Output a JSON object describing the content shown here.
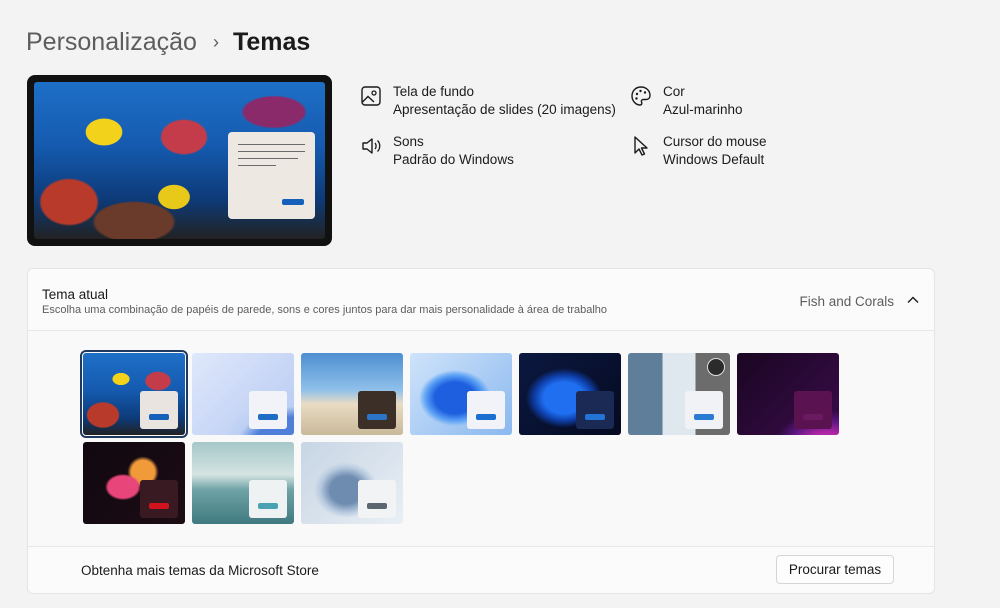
{
  "breadcrumb": {
    "parent": "Personalização",
    "separator": "›",
    "current": "Temas"
  },
  "properties": {
    "background": {
      "label": "Tela de fundo",
      "value": "Apresentação de slides (20 imagens)",
      "icon": "image-icon"
    },
    "color": {
      "label": "Cor",
      "value": "Azul-marinho",
      "icon": "palette-icon"
    },
    "sounds": {
      "label": "Sons",
      "value": "Padrão do Windows",
      "icon": "speaker-icon"
    },
    "cursor": {
      "label": "Cursor do mouse",
      "value": "Windows Default",
      "icon": "cursor-icon"
    }
  },
  "current_theme": {
    "title": "Tema atual",
    "subtitle": "Escolha uma combinação de papéis de parede, sons e cores juntos para dar mais personalidade à área de trabalho",
    "value": "Fish and Corals",
    "expanded": true
  },
  "themes": [
    {
      "name": "fish-and-corals",
      "selected": true,
      "bg": "fish",
      "mini": "#e9e4df",
      "btn": "#1560b8"
    },
    {
      "name": "windows-light-glow",
      "selected": false,
      "bg": "glowlight",
      "mini": "#f1f3f8",
      "btn": "#1f6ec4"
    },
    {
      "name": "beach-sky",
      "selected": false,
      "bg": "beach",
      "mini": "#3b2f28",
      "btn": "#2b74c8"
    },
    {
      "name": "windows-light-bloom",
      "selected": false,
      "bg": "bloomlight",
      "mini": "#f1f3f8",
      "btn": "#1a6fd0"
    },
    {
      "name": "windows-dark-bloom",
      "selected": false,
      "bg": "bloomdark",
      "mini": "#1b2a55",
      "btn": "#2474d8"
    },
    {
      "name": "blossom-photo",
      "selected": false,
      "bg": "blossom",
      "mini": "#f0f2f6",
      "btn": "#2a7bd2",
      "badge": true
    },
    {
      "name": "purple-glow",
      "selected": false,
      "bg": "purple",
      "mini": "#5a1350",
      "btn": "#6a1a60"
    },
    {
      "name": "captured-motion",
      "selected": false,
      "bg": "flower",
      "mini": "#3a1a22",
      "btn": "#d0131d"
    },
    {
      "name": "lake-sunrise",
      "selected": false,
      "bg": "lake",
      "mini": "#eef2f2",
      "btn": "#4aa3b3"
    },
    {
      "name": "flow",
      "selected": false,
      "bg": "flow",
      "mini": "#f1f3f5",
      "btn": "#5b6670"
    }
  ],
  "store": {
    "text": "Obtenha mais temas da Microsoft Store",
    "button": "Procurar temas"
  }
}
